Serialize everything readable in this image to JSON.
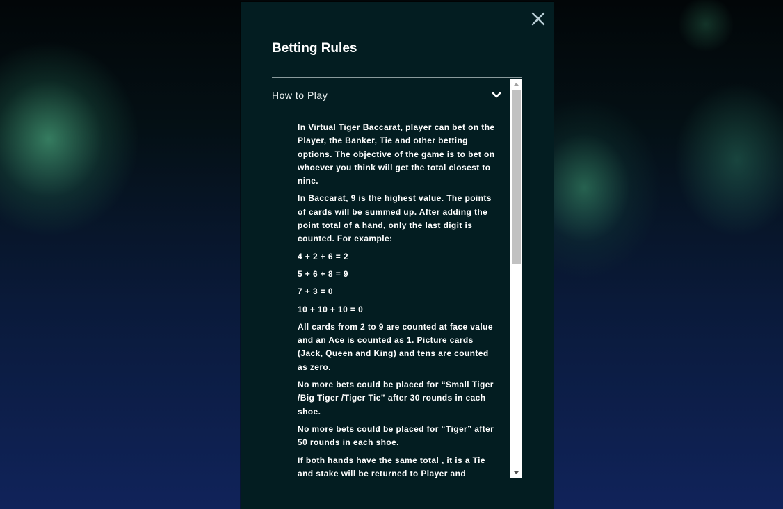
{
  "modal": {
    "title": "Betting Rules",
    "close_icon": "close-x-icon"
  },
  "section": {
    "label": "How to Play",
    "expanded": true,
    "toggle_icon": "chevron-down-icon",
    "paragraphs": [
      "In Virtual Tiger Baccarat, player can bet on the Player, the Banker, Tie and other betting options. The objective of the game is to bet on whoever you think will get the total closest to nine.",
      "In Baccarat, 9 is the highest value. The points of cards will be summed up. After adding the point total of a hand, only the last digit is counted. For example:",
      "4 + 2 + 6 = 2",
      "5 + 6 + 8 = 9",
      "7 + 3 = 0",
      "10 + 10 + 10 = 0",
      "All cards from 2 to 9 are counted at face value and an Ace is counted as 1. Picture cards (Jack, Queen and King) and tens are counted as zero.",
      "No more bets could be placed for “Small Tiger /Big Tiger /Tiger Tie” after 30 rounds in each shoe.",
      "No more bets could be placed for “Tiger” after 50 rounds in each shoe.",
      "If both hands have the same total , it is a Tie and stake will be returned to Player and"
    ]
  },
  "scrollbar": {
    "thumb_fraction": 0.46,
    "scroll_position": 0
  },
  "colors": {
    "modal_bg": "#031d21",
    "text": "#ffffff",
    "close_icon": "#b9cfd6",
    "scroll_thumb": "#c1c1c1"
  }
}
